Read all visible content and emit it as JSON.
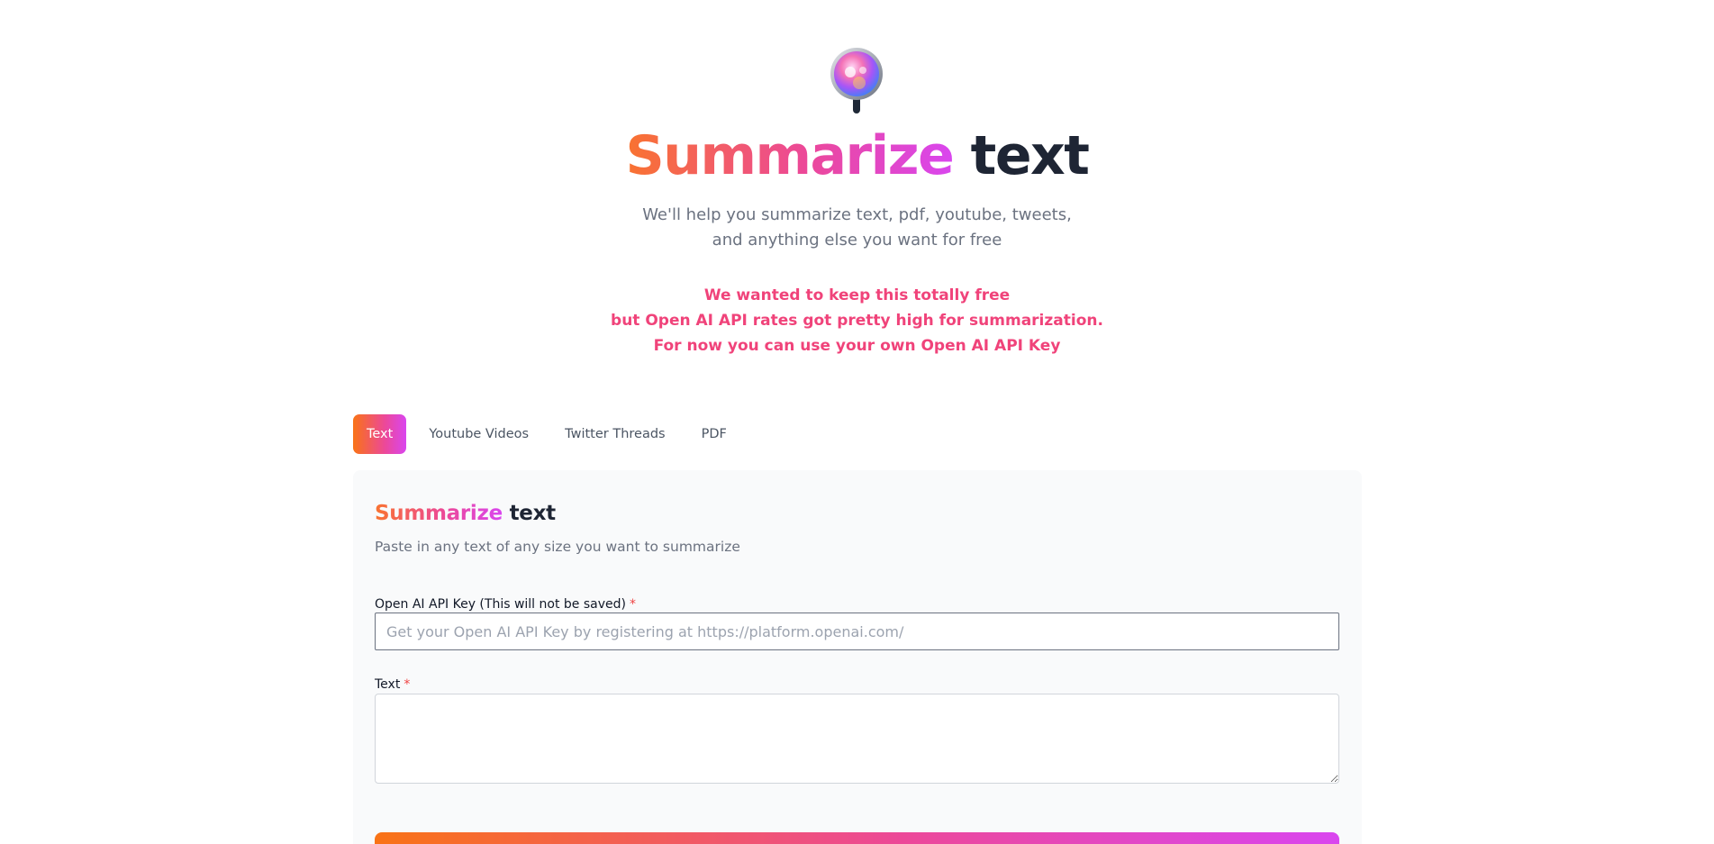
{
  "hero": {
    "title_accent": "Summarize",
    "title_rest": " text",
    "subtitle_line1": "We'll help you summarize text, pdf, youtube, tweets,",
    "subtitle_line2": "and anything else you want for free",
    "notice_line1": "We wanted to keep this totally free",
    "notice_line2": "but Open AI API rates got pretty high for summarization.",
    "notice_line3": "For now you can use your own Open AI API Key",
    "logo_icon": "magnifier-orb-icon"
  },
  "tabs": [
    {
      "label": "Text",
      "active": true
    },
    {
      "label": "Youtube Videos",
      "active": false
    },
    {
      "label": "Twitter Threads",
      "active": false
    },
    {
      "label": "PDF",
      "active": false
    }
  ],
  "panel": {
    "title_accent": "Summarize",
    "title_rest": " text",
    "description": "Paste in any text of any size you want to summarize",
    "api_key_label": "Open AI API Key (This will not be saved)",
    "api_key_placeholder": "Get your Open AI API Key by registering at https://platform.openai.com/",
    "api_key_value": "",
    "text_label": "Text",
    "text_value": "",
    "required_mark": "*"
  },
  "colors": {
    "accent_start": "#f97316",
    "accent_mid": "#ec4899",
    "accent_end": "#d946ef",
    "notice": "#f0437a",
    "dark": "#1e2534"
  }
}
